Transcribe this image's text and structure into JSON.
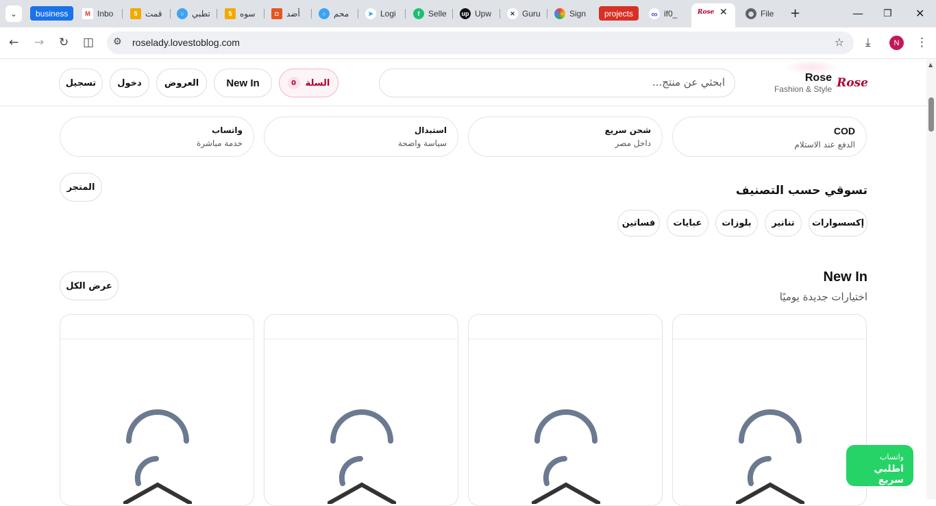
{
  "browser": {
    "tabs": [
      {
        "label": "business",
        "kind": "chip",
        "color": "#1a73e8"
      },
      {
        "label": "Inbo",
        "icon": "gmail-icon"
      },
      {
        "label": "قمت",
        "icon": "five-icon"
      },
      {
        "label": "تطبي",
        "icon": "blue-ring-icon"
      },
      {
        "label": "سوه",
        "icon": "five-icon"
      },
      {
        "label": "أضد",
        "icon": "orange-icon"
      },
      {
        "label": "محم",
        "icon": "blue-ring-icon"
      },
      {
        "label": "Logi",
        "icon": "bird-icon"
      },
      {
        "label": "Selle",
        "icon": "fiverr-icon"
      },
      {
        "label": "Upw",
        "icon": "upwork-icon"
      },
      {
        "label": "Guru",
        "icon": "handshake-icon"
      },
      {
        "label": "Sign",
        "icon": "color-ring-icon"
      },
      {
        "label": "projects",
        "kind": "chip",
        "color": "#d93025"
      },
      {
        "label": "if0_",
        "icon": "infinity-icon"
      },
      {
        "label": "",
        "icon": "rose-favicon",
        "active": true
      },
      {
        "label": "File",
        "icon": "globe-icon"
      }
    ],
    "url": "roselady.lovestoblog.com",
    "profile_initial": "N"
  },
  "site": {
    "brand_name": "Rose",
    "brand_tagline": "Fashion & Style",
    "logo_text": "Rose",
    "search_placeholder": "ابحثي عن منتج...",
    "cart_label": "السلة",
    "cart_count": "0",
    "nav": {
      "new_in": "New In",
      "offers": "العروض",
      "login": "دخول",
      "register": "تسجيل"
    }
  },
  "features": [
    {
      "title": "COD",
      "subtitle": "الدفع عند الاستلام"
    },
    {
      "title": "شحن سريع",
      "subtitle": "داخل مصر"
    },
    {
      "title": "استبدال",
      "subtitle": "سياسة واضحة"
    },
    {
      "title": "واتساب",
      "subtitle": "خدمة مباشرة"
    }
  ],
  "categories_section": {
    "title": "تسوقي حسب التصنيف",
    "store_button": "المتجر",
    "items": [
      "إكسسوارات",
      "تنانير",
      "بلوزات",
      "عبايات",
      "فساتين"
    ]
  },
  "new_in_section": {
    "title": "New In",
    "subtitle": "اختيارات جديدة يوميًا",
    "view_all": "عرض الكل",
    "product_count": 4
  },
  "whatsapp_float": {
    "line1": "واتساب",
    "line2": "اطلبي سريع",
    "color": "#25d366"
  }
}
